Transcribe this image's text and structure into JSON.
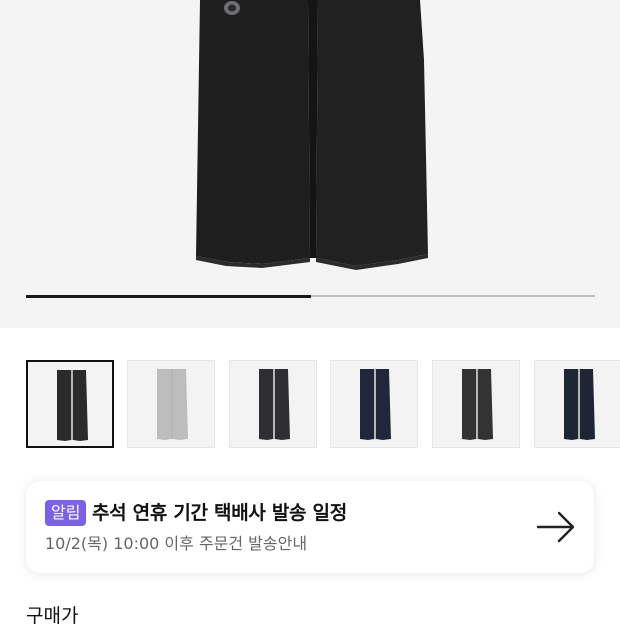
{
  "gallery": {
    "image": "black wide-leg pants product photo",
    "progress": 0.5,
    "thumbnails": [
      {
        "name": "black",
        "color": "#2b2b2b",
        "selected": true
      },
      {
        "name": "gray",
        "color": "#bdbdbd",
        "selected": false
      },
      {
        "name": "charcoal",
        "color": "#2e2e33",
        "selected": false
      },
      {
        "name": "navy",
        "color": "#23253a",
        "selected": false
      },
      {
        "name": "dark-gray",
        "color": "#333333",
        "selected": false
      },
      {
        "name": "dark-navy",
        "color": "#1e2533",
        "selected": false
      }
    ]
  },
  "notice": {
    "badge": "알림",
    "title": "추석 연휴 기간 택배사 발송 일정",
    "subtitle": "10/2(목) 10:00 이후 주문건 발송안내",
    "arrow_icon": "arrow-right-icon",
    "badge_color": "#7b61e8"
  },
  "price": {
    "label": "구매가"
  }
}
